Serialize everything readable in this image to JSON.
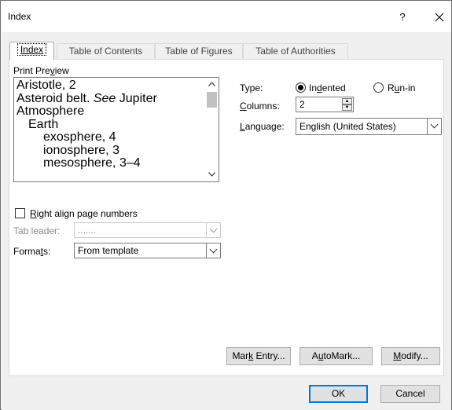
{
  "window": {
    "title": "Index",
    "help_label": "?",
    "close_label": "✕"
  },
  "tabs": [
    {
      "label": "Index",
      "active": true
    },
    {
      "label": "Table of Contents",
      "active": false
    },
    {
      "label": "Table of Figures",
      "active": false
    },
    {
      "label": "Table of Authorities",
      "active": false
    }
  ],
  "preview": {
    "label": "Print Preview",
    "lines": [
      {
        "text": "Aristotle, 2"
      },
      {
        "text": "Asteroid belt.",
        "italic": "See",
        "after": "Jupiter"
      },
      {
        "text": "Atmosphere"
      },
      {
        "text": "Earth",
        "indent": 1
      },
      {
        "text": "exosphere, 4",
        "indent": 2
      },
      {
        "text": "ionosphere, 3",
        "indent": 2
      },
      {
        "text": "mesosphere, 3–4",
        "indent": 2
      }
    ]
  },
  "options": {
    "type_label": "Type:",
    "type_options": [
      {
        "label": "Indented",
        "selected": true
      },
      {
        "label": "Run-in",
        "selected": false
      }
    ],
    "columns_label": "Columns:",
    "columns_value": "2",
    "language_label": "Language:",
    "language_value": "English (United States)"
  },
  "right_align": {
    "label": "Right align page numbers",
    "checked": false
  },
  "tab_leader": {
    "label": "Tab leader:",
    "value": "......."
  },
  "formats": {
    "label": "Formats:",
    "value": "From template"
  },
  "buttons": {
    "mark_entry": "Mark Entry...",
    "automark": "AutoMark...",
    "modify": "Modify...",
    "ok": "OK",
    "cancel": "Cancel"
  },
  "colors": {
    "accent": "#0078d7",
    "dialog_bg": "#f0f0f0",
    "panel_bg": "#ffffff"
  }
}
